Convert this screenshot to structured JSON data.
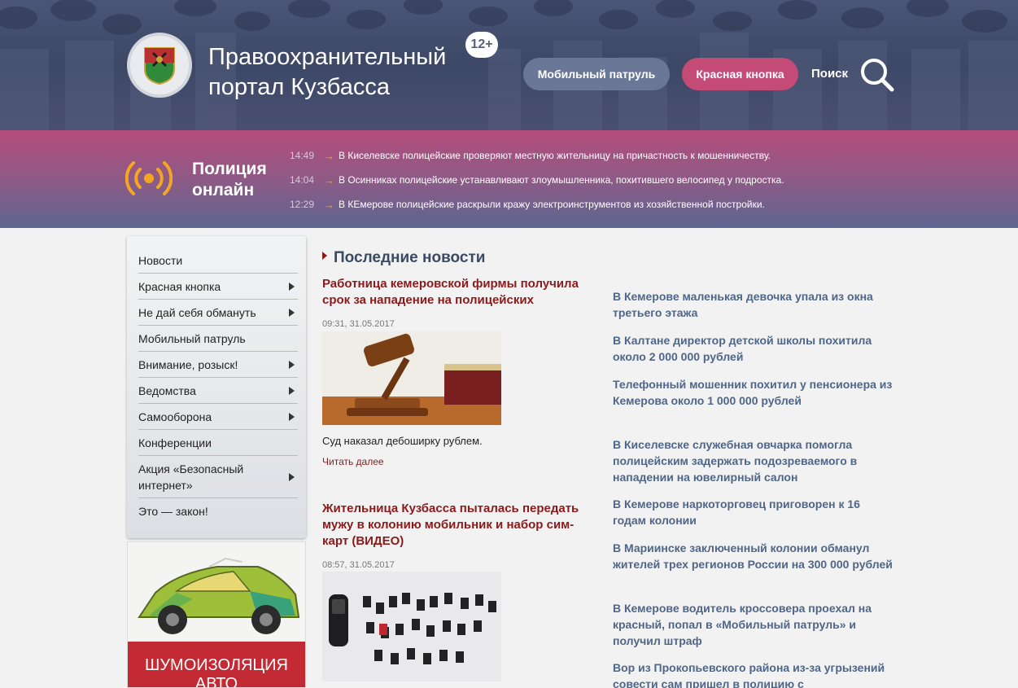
{
  "header": {
    "title_line1": "Правоохранительный",
    "title_line2": "портал Кузбасса",
    "age_badge": "12+",
    "mobile_patrol": "Мобильный патруль",
    "red_button": "Красная кнопка",
    "search": "Поиск"
  },
  "online": {
    "title_line1": "Полиция",
    "title_line2": "онлайн",
    "feed": [
      {
        "time": "14:49",
        "text": "В Киселевске полицейские проверяют местную жительницу на причастность к мошенничеству."
      },
      {
        "time": "14:04",
        "text": "В Осинниках полицейские устанавливают злоумышленника, похитившего велосипед у подростка."
      },
      {
        "time": "12:29",
        "text": "В КЕмерове полицейские раскрыли кражу электроинструментов из хозяйственной постройки."
      }
    ]
  },
  "menu": [
    {
      "label": "Новости"
    },
    {
      "label": "Красная кнопка"
    },
    {
      "label": "Не дай себя обмануть"
    },
    {
      "label": "Мобильный патруль"
    },
    {
      "label": "Внимание, розыск!"
    },
    {
      "label": "Ведомства"
    },
    {
      "label": "Самооборона"
    },
    {
      "label": "Конференции"
    },
    {
      "label": "Акция «Безопасный интернет»"
    },
    {
      "label": "Это — закон!"
    }
  ],
  "ad": {
    "text": "ШУМОИЗОЛЯЦИЯ АВТО"
  },
  "news": {
    "heading": "Последние новости",
    "items": [
      {
        "title": "Работница кемеровской фирмы получила срок за нападение на полицейских",
        "date": "09:31, 31.05.2017",
        "lead": "Суд наказал дебоширку рублем.",
        "more": "Читать далее"
      },
      {
        "title": "Жительница Кузбасса пыталась передать мужу в колонию мобильник и набор сим-карт (ВИДЕО)",
        "date": "08:57, 31.05.2017"
      }
    ]
  },
  "sidebar_news": [
    "В Кемерове маленькая девочка упала из окна третьего этажа",
    "В Калтане директор детской школы похитила около 2 000 000 рублей",
    "Телефонный мошенник похитил у пенсионера из Кемерова около 1 000 000 рублей",
    "В Киселевске служебная овчарка помогла полицейским задержать подозреваемого в нападении на ювелирный салон",
    "В Кемерове наркоторговец приговорен к 16 годам колонии",
    "В Мариинске заключенный колонии обманул жителей трех регионов России на 300 000 рублей",
    "В Кемерове водитель кроссовера проехал на красный, попал в «Мобильный патруль» и получил штраф",
    "Вор из Прокопьевского района из-за угрызений совести сам пришел в полицию с"
  ],
  "colors": {
    "accent_red": "#8b1a1a",
    "link_blue": "#4f6688",
    "pill_patrol": "#6b7797",
    "pill_red": "#c44b76",
    "feed_arrow": "#f4a623"
  }
}
